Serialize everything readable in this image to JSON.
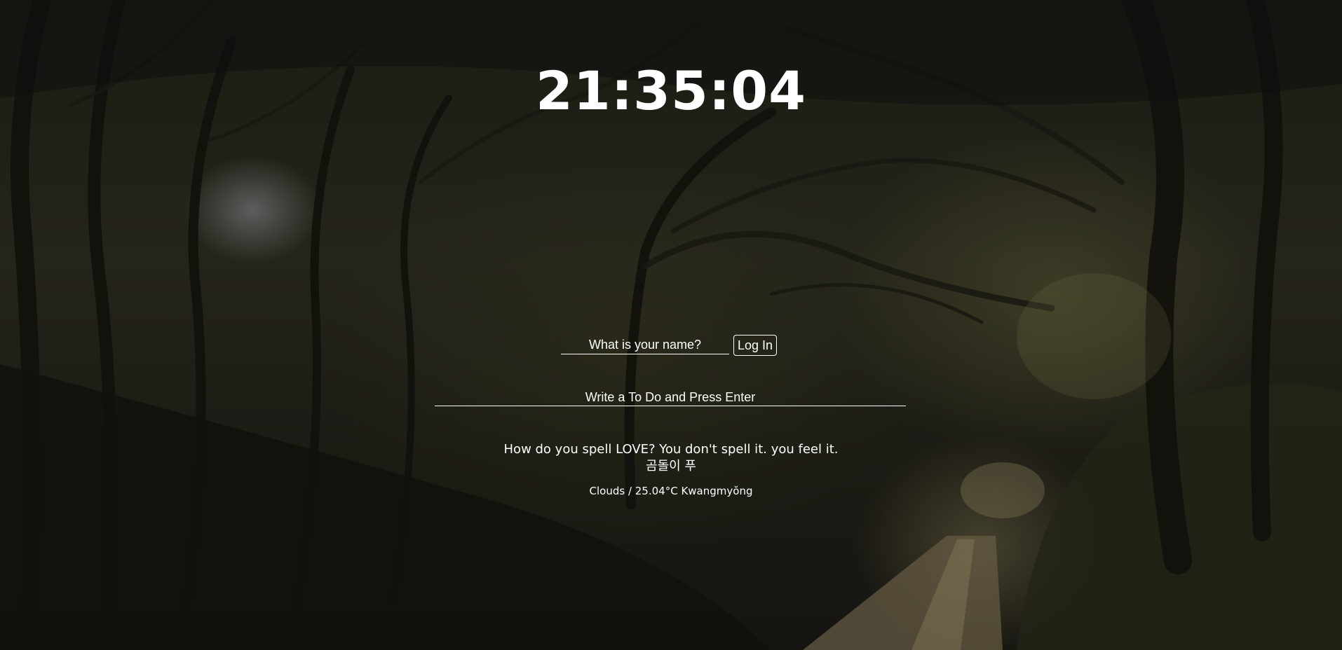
{
  "clock": {
    "time": "21:35:04"
  },
  "login": {
    "placeholder": "What is your name?",
    "button_label": "Log In"
  },
  "todo": {
    "placeholder": "Write a To Do and Press Enter"
  },
  "quote": {
    "text": "How do you spell LOVE? You don't spell it. you feel it.",
    "author": "곰돌이 푸"
  },
  "weather": {
    "text": "Clouds / 25.04°C Kwangmyŏng"
  }
}
